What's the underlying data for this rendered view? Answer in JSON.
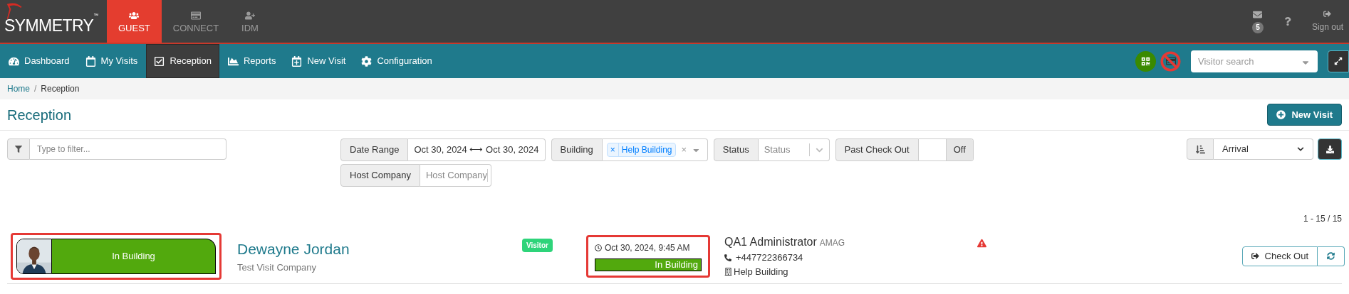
{
  "logo": {
    "text": "SYMMETRY",
    "mark": "™"
  },
  "apps": [
    {
      "label": "GUEST",
      "selected": true
    },
    {
      "label": "CONNECT",
      "selected": false
    },
    {
      "label": "IDM",
      "selected": false
    }
  ],
  "top_right": {
    "mail_count": "5",
    "sign_out": "Sign out"
  },
  "nav": [
    {
      "label": "Dashboard",
      "selected": false
    },
    {
      "label": "My Visits",
      "selected": false
    },
    {
      "label": "Reception",
      "selected": true
    },
    {
      "label": "Reports",
      "selected": false
    },
    {
      "label": "New Visit",
      "selected": false
    },
    {
      "label": "Configuration",
      "selected": false
    }
  ],
  "visitor_search": {
    "placeholder": "Visitor search"
  },
  "breadcrumb": {
    "separator": "/",
    "items": [
      {
        "label": "Home",
        "selected": false
      },
      {
        "label": "Reception",
        "selected": true
      }
    ]
  },
  "page_title": "Reception",
  "new_visit_button": "New Visit",
  "filter": {
    "placeholder": "Type to filter..."
  },
  "filters": [
    {
      "kind": "date",
      "label": "Date Range",
      "from": "Oct 30, 2024",
      "arrow": "⟷",
      "to": "Oct 30, 2024"
    },
    {
      "kind": "tags",
      "label": "Building",
      "tags": [
        "Help Building"
      ],
      "remove": "×",
      "clear": "×"
    },
    {
      "kind": "select",
      "label": "Status",
      "placeholder": "Status"
    },
    {
      "kind": "toggle",
      "label": "Past Check Out",
      "value": "Off",
      "on": false
    },
    {
      "kind": "select",
      "label": "Host Company",
      "placeholder": "Host Company"
    }
  ],
  "sort": {
    "value": "Arrival"
  },
  "pagination": "1 - 15 / 15",
  "visits": [
    {
      "status": "In Building",
      "name": "Dewayne Jordan",
      "company": "Test Visit Company",
      "type": "Visitor",
      "time": "Oct 30, 2024, 9:45 AM",
      "time_status": "In Building",
      "host": "QA1 Administrator",
      "host_company": "AMAG",
      "phone": "+447722366734",
      "building": "Help Building",
      "warning": true,
      "check_out": "Check Out"
    }
  ]
}
